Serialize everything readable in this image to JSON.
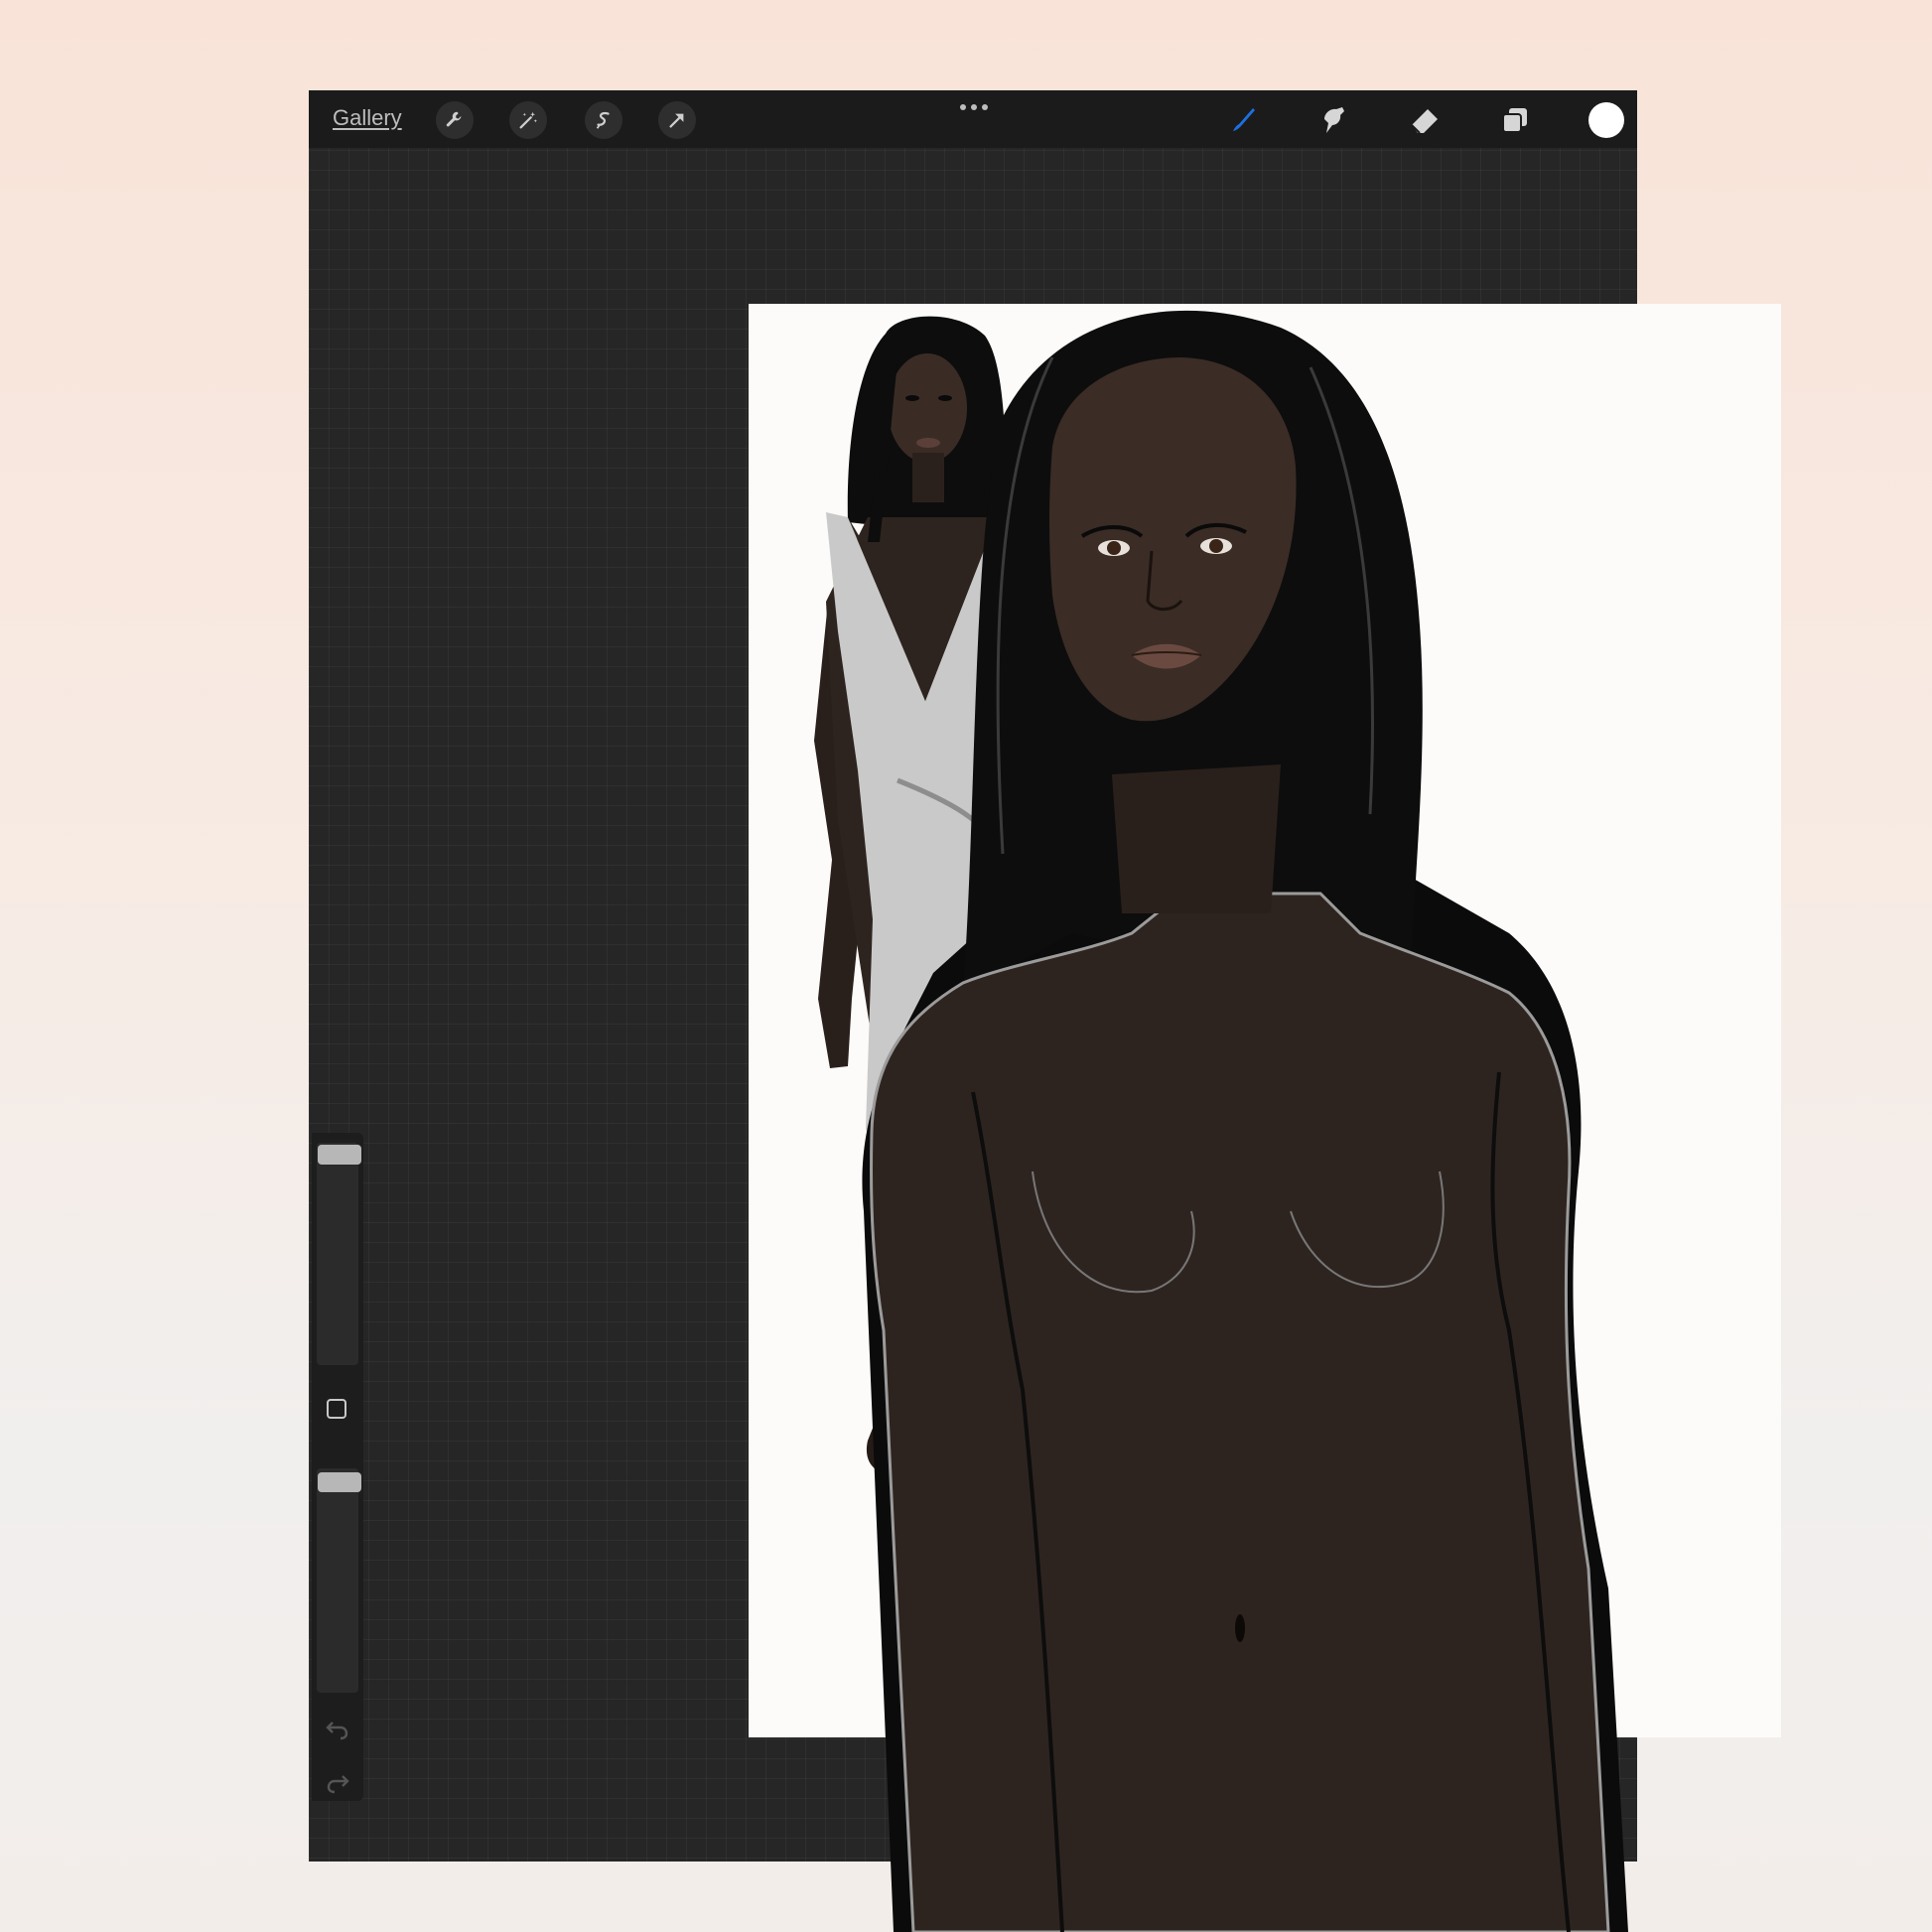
{
  "toolbar": {
    "gallery_label": "Gallery",
    "left_tools": [
      "wrench-icon",
      "magic-wand-icon",
      "selection-icon",
      "transform-arrow-icon"
    ],
    "right_tools": [
      "brush-icon",
      "smudge-icon",
      "eraser-icon",
      "layers-icon"
    ],
    "active_tool": "brush",
    "active_color": "#ffffff",
    "accent_color": "#1e6fe0"
  },
  "sidebar": {
    "brush_size": 0.94,
    "opacity": 1.0,
    "controls": [
      "brush-size-slider",
      "modify-button",
      "opacity-slider",
      "undo-icon",
      "redo-icon"
    ]
  },
  "colors": {
    "background_top": "#f9e3d8",
    "background_bottom": "#f3edea",
    "app_background": "#262626",
    "toolbar": "#1b1b1b",
    "canvas": "#fcfbf9",
    "skin": "#2e241f",
    "hair": "#0c0c0c",
    "dress": "#c7c7c7"
  }
}
